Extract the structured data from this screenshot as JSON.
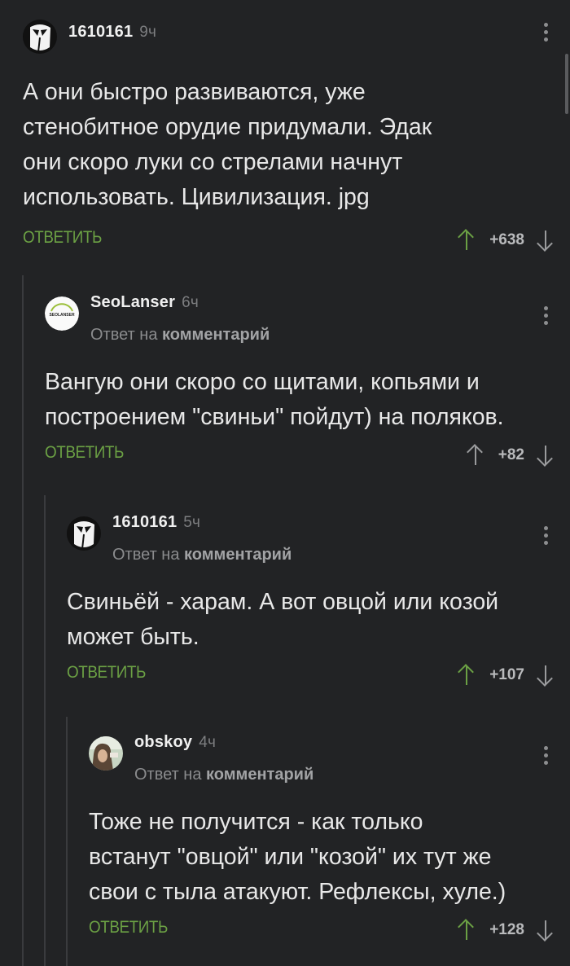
{
  "reply_label": "ОТВЕТИТЬ",
  "reply_to_prefix": "Ответ на",
  "reply_to_target": "комментарий",
  "comments": [
    {
      "username": "1610161",
      "time": "9ч",
      "avatar": "mask-avatar",
      "text_lines": [
        "А они быстро развиваются, уже",
        "стенобитное орудие придумали. Эдак",
        "они скоро луки со стрелами начнут",
        "использовать. Цивилизация. jpg"
      ],
      "score": "+638"
    },
    {
      "username": "SeoLanser",
      "time": "6ч",
      "avatar": "seolanser-logo",
      "avatar_text": "SEOLANSER",
      "text_lines": [
        "Вангую они скоро со щитами, копьями и",
        "построением \"свиньи\" пойдут) на поляков."
      ],
      "score": "+82"
    },
    {
      "username": "1610161",
      "time": "5ч",
      "avatar": "mask-avatar",
      "text_lines": [
        "Свиньёй - харам. А вот овцой или козой",
        "может быть."
      ],
      "score": "+107"
    },
    {
      "username": "obskoy",
      "time": "4ч",
      "avatar": "photo-avatar",
      "text_lines": [
        "Тоже не получится - как только",
        "встанут \"овцой\" или \"козой\" их тут же",
        "свои с тыла атакуют. Рефлексы, хуле.)"
      ],
      "score": "+128"
    }
  ],
  "colors": {
    "background": "#222325",
    "accent_green": "#6ba044",
    "thread_line": "#3a3b3e"
  }
}
